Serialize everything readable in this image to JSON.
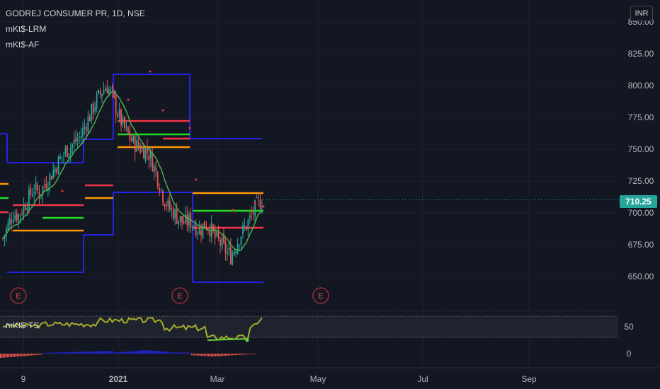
{
  "header": {
    "symbol_title": "GODREJ CONSUMER PR, 1D, NSE",
    "indicator_1": "mKt$-LRM",
    "indicator_2": "mKt$-AF",
    "currency": "INR"
  },
  "price_badge": "710.25",
  "lower_pane": {
    "indicator_label": "mKt$-TS"
  },
  "colors": {
    "background": "#131722",
    "up_candle": "#26a69a",
    "down_candle": "#ef5350",
    "channel": "#2323e8",
    "level_red": "#f23645",
    "level_orange": "#ff9800",
    "level_green": "#22dd22",
    "ma": "#4caf50",
    "oscillator": "#a5ad2b",
    "earnings": "#9c2b3a"
  },
  "chart_data": [
    {
      "type": "candlestick",
      "price_ticks": [
        "650.00",
        "675.00",
        "700.00",
        "725.00",
        "750.00",
        "775.00",
        "800.00",
        "825.00",
        "850.00"
      ],
      "x_ticks": [
        "9",
        "2021",
        "Mar",
        "May",
        "Jul",
        "Sep"
      ],
      "ylim": [
        625,
        850
      ],
      "last_price": 710.25,
      "close_series": [
        680,
        690,
        700,
        698,
        705,
        712,
        720,
        715,
        722,
        728,
        735,
        742,
        748,
        752,
        756,
        760,
        770,
        778,
        788,
        795,
        800,
        793,
        780,
        770,
        762,
        756,
        752,
        750,
        748,
        738,
        726,
        712,
        704,
        700,
        695,
        692,
        694,
        690,
        686,
        692,
        688,
        680,
        676,
        670,
        666,
        675,
        684,
        690,
        698,
        706,
        710.25
      ],
      "earnings_markers": [
        "E",
        "E",
        "E"
      ]
    },
    {
      "type": "line",
      "series": [
        {
          "name": "mKt$-TS"
        }
      ],
      "y_ticks": [
        "0",
        "50"
      ]
    }
  ]
}
